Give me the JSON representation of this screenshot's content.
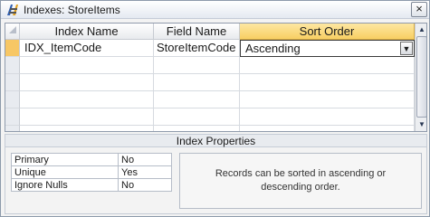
{
  "window": {
    "title": "Indexes: StoreItems",
    "close_glyph": "×"
  },
  "grid": {
    "columns": [
      "Index Name",
      "Field Name",
      "Sort Order"
    ],
    "rows": [
      {
        "index_name": "IDX_ItemCode",
        "field_name": "StoreItemCode",
        "sort_order": "Ascending"
      }
    ],
    "dropdown_glyph": "▼",
    "scroll_up_glyph": "▲",
    "scroll_down_glyph": "▼"
  },
  "properties": {
    "title": "Index Properties",
    "items": [
      {
        "label": "Primary",
        "value": "No"
      },
      {
        "label": "Unique",
        "value": "Yes"
      },
      {
        "label": "Ignore Nulls",
        "value": "No"
      }
    ],
    "description": "Records can be sorted in ascending or descending order."
  },
  "colors": {
    "header_selected": "#f8cf63",
    "row_selector_current": "#f7c765"
  }
}
